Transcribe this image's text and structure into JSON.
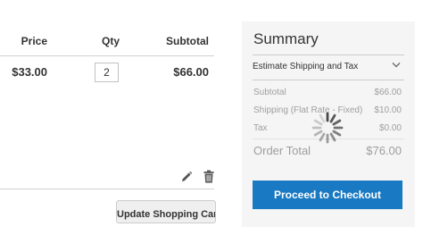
{
  "cart": {
    "columns": {
      "price": "Price",
      "qty": "Qty",
      "subtotal": "Subtotal"
    },
    "item": {
      "price": "$33.00",
      "qty": "2",
      "subtotal": "$66.00"
    },
    "actions": {
      "edit_icon": "pencil-icon",
      "delete_icon": "trash-icon"
    },
    "update_button_label": "Update Shopping Cart"
  },
  "summary": {
    "title": "Summary",
    "shipping_toggle_label": "Estimate Shipping and Tax",
    "rows": {
      "subtotal": {
        "label": "Subtotal",
        "value": "$66.00"
      },
      "shipping": {
        "label": "Shipping (Flat Rate - Fixed)",
        "value": "$10.00"
      },
      "tax": {
        "label": "Tax",
        "value": "$0.00"
      }
    },
    "order_total": {
      "label": "Order Total",
      "value": "$76.00"
    },
    "checkout_button_label": "Proceed to Checkout",
    "loading_icon": "spinner-icon"
  },
  "colors": {
    "accent": "#1979c3",
    "summary_bg": "#f5f5f5",
    "text": "#333333"
  }
}
